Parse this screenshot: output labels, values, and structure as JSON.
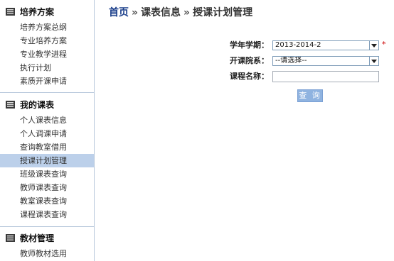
{
  "sidebar": {
    "sections": [
      {
        "title": "培养方案",
        "icon": "document-list-icon",
        "items": [
          "培养方案总纲",
          "专业培养方案",
          "专业教学进程",
          "执行计划",
          "素质开课申请"
        ]
      },
      {
        "title": "我的课表",
        "icon": "document-list-icon",
        "items": [
          "个人课表信息",
          "个人调课申请",
          "查询教室借用",
          "授课计划管理",
          "班级课表查询",
          "教师课表查询",
          "教室课表查询",
          "课程课表查询"
        ],
        "active_item": "授课计划管理"
      },
      {
        "title": "教材管理",
        "icon": "document-list-icon",
        "items": [
          "教师教材选用"
        ]
      }
    ]
  },
  "breadcrumb": {
    "home": "首页",
    "separator": "»",
    "level1": "课表信息",
    "level2": "授课计划管理"
  },
  "form": {
    "term_label": "学年学期：",
    "term_value": "2013-2014-2",
    "required_mark": "*",
    "dept_label": "开课院系：",
    "dept_value": "--请选择--",
    "course_label": "课程名称：",
    "course_value": "",
    "query_button": "查 询"
  },
  "colors": {
    "active_bg": "#bcd0ea",
    "link": "#1a3e8a",
    "button": "#8fb3e0",
    "required": "#cc0000"
  }
}
